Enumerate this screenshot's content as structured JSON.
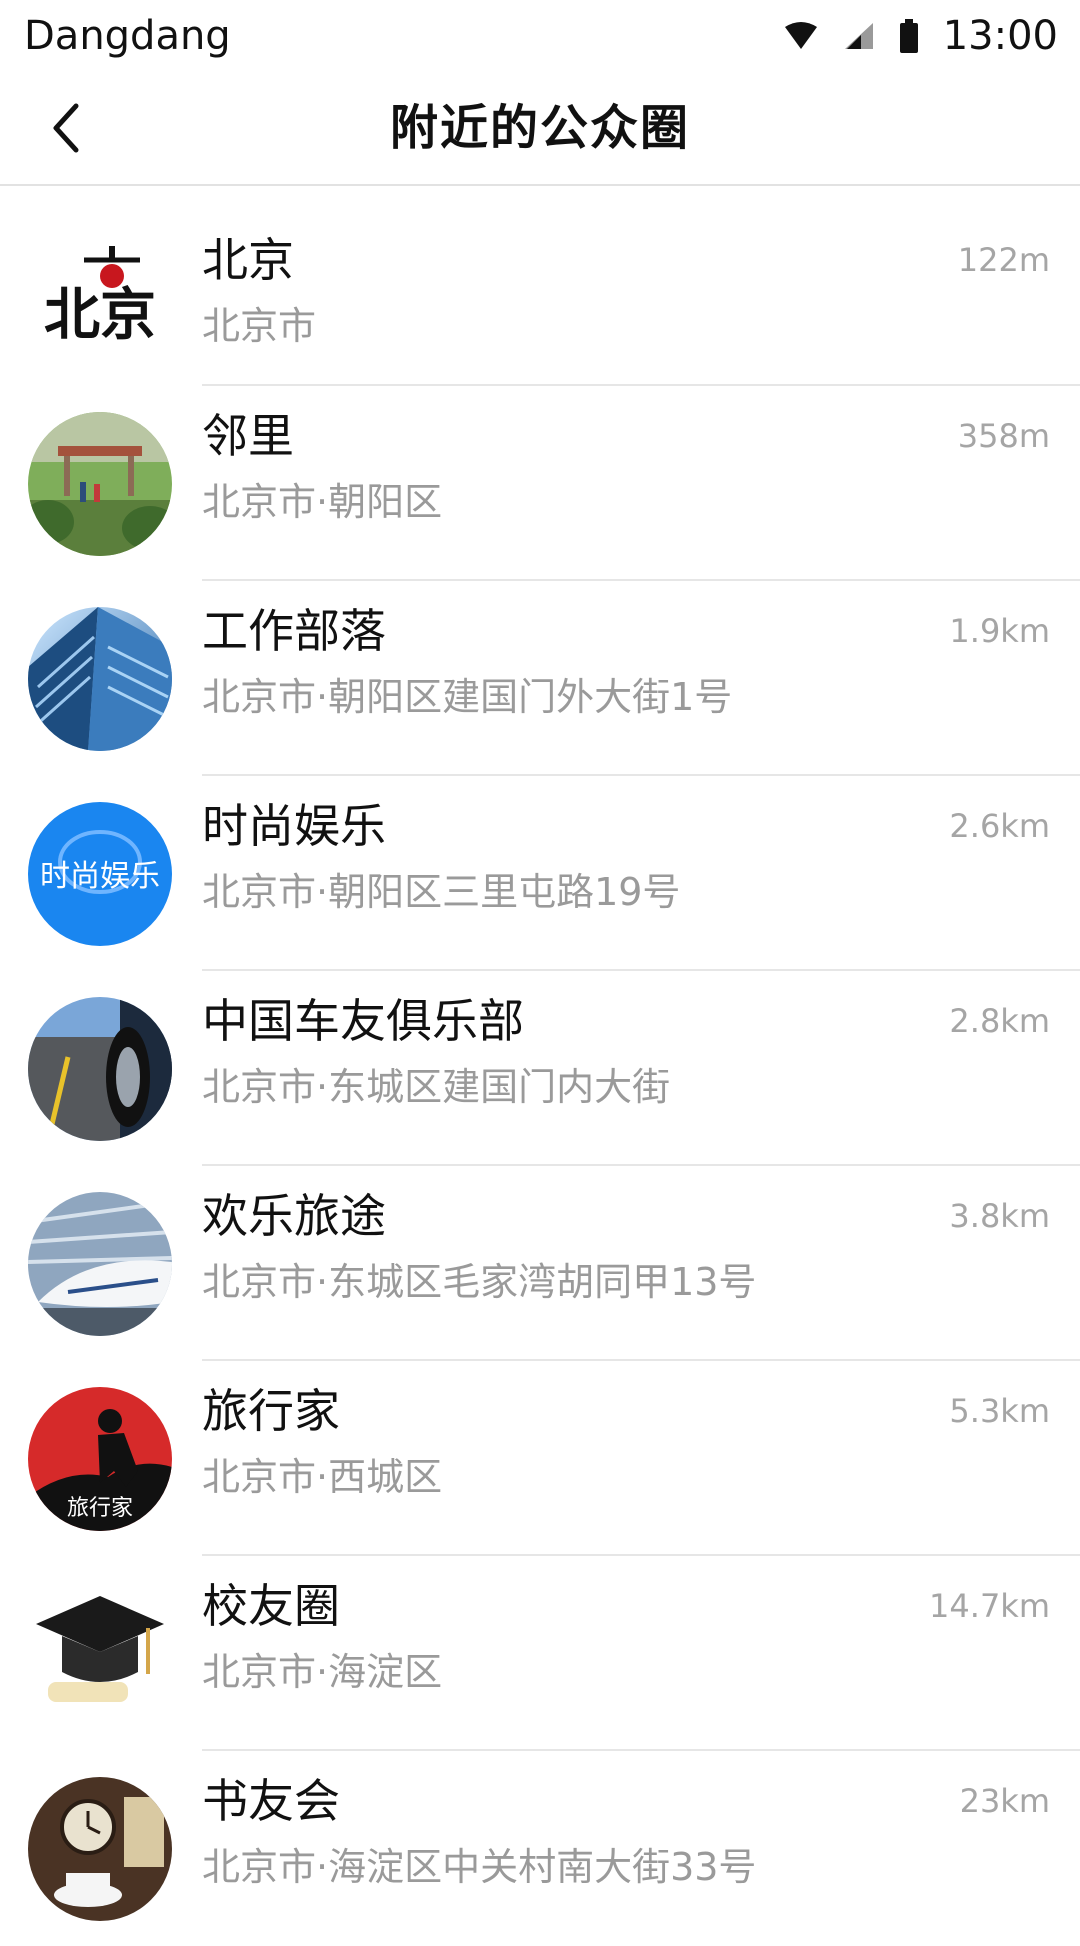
{
  "status_bar": {
    "carrier": "Dangdang",
    "time": "13:00",
    "icons": [
      "wifi-icon",
      "cellular-signal-icon",
      "battery-icon"
    ]
  },
  "header": {
    "title": "附近的公众圈",
    "back_icon": "chevron-left-icon"
  },
  "circles": [
    {
      "name": "北京",
      "address": "北京市",
      "distance": "122m",
      "avatar": "beijing-calligraphy-logo",
      "avatar_text": "北京"
    },
    {
      "name": "邻里",
      "address": "北京市·朝阳区",
      "distance": "358m",
      "avatar": "park-pavilion-photo"
    },
    {
      "name": "工作部落",
      "address": "北京市·朝阳区建国门外大街1号",
      "distance": "1.9km",
      "avatar": "office-building-photo"
    },
    {
      "name": "时尚娱乐",
      "address": "北京市·朝阳区三里屯路19号",
      "distance": "2.6km",
      "avatar": "fashion-entertainment-logo",
      "avatar_text": "时尚娱乐"
    },
    {
      "name": "中国车友俱乐部",
      "address": "北京市·东城区建国门内大街",
      "distance": "2.8km",
      "avatar": "car-wheel-road-photo"
    },
    {
      "name": "欢乐旅途",
      "address": "北京市·东城区毛家湾胡同甲13号",
      "distance": "3.8km",
      "avatar": "high-speed-train-photo"
    },
    {
      "name": "旅行家",
      "address": "北京市·西城区",
      "distance": "5.3km",
      "avatar": "hiker-silhouette-logo",
      "avatar_text": "旅行家"
    },
    {
      "name": "校友圈",
      "address": "北京市·海淀区",
      "distance": "14.7km",
      "avatar": "graduation-cap-photo"
    },
    {
      "name": "书友会",
      "address": "北京市·海淀区中关村南大街33号",
      "distance": "23km",
      "avatar": "books-clock-coffee-photo"
    }
  ],
  "colors": {
    "divider": "#e6e6e6",
    "secondary_text": "#9a9a9a",
    "fashion_blue": "#1a86f0",
    "traveler_red": "#d62a2a"
  }
}
